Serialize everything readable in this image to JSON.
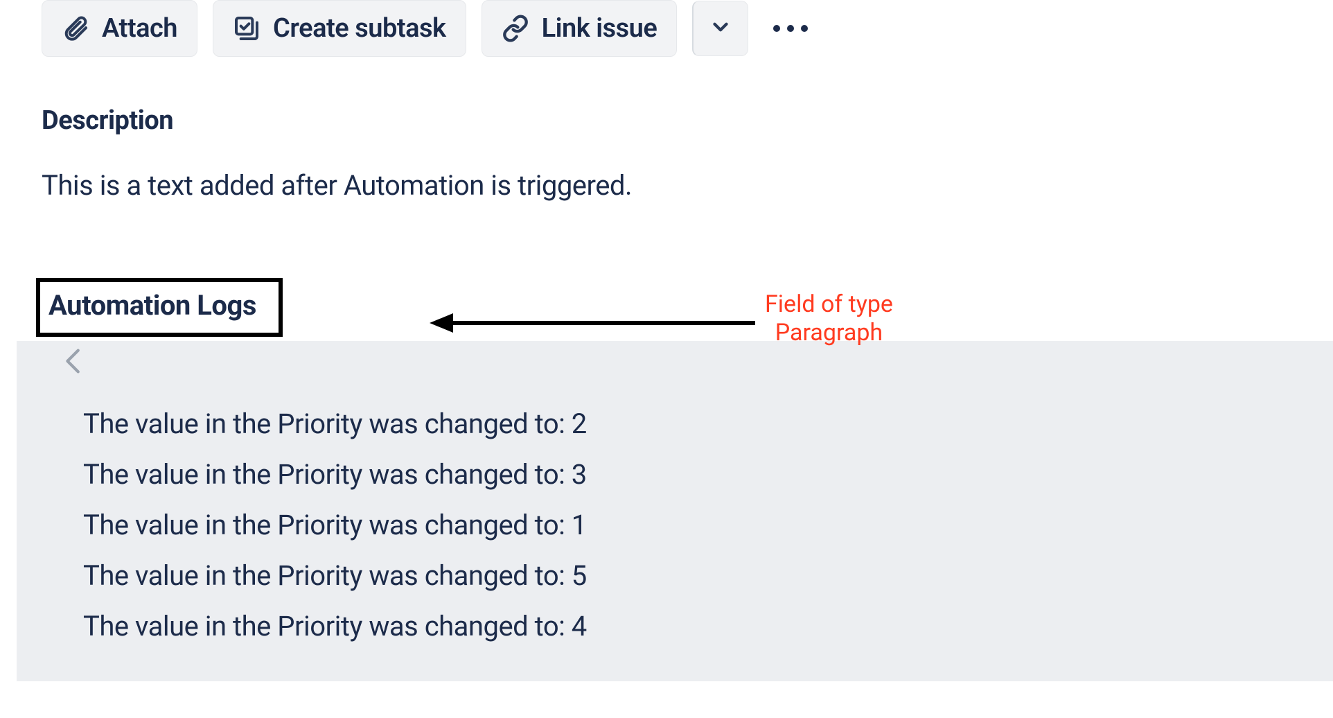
{
  "toolbar": {
    "attach_label": "Attach",
    "create_subtask_label": "Create subtask",
    "link_issue_label": "Link issue"
  },
  "description": {
    "heading": "Description",
    "text": "This is a text added after Automation is triggered."
  },
  "automation_logs": {
    "heading": "Automation Logs",
    "lines": [
      "The value in the Priority was changed to: 2",
      "The value in the Priority was changed to: 3",
      "The value in the Priority was changed to: 1",
      "The value in the Priority was changed to: 5",
      "The value in the Priority was changed to: 4"
    ]
  },
  "annotation": {
    "line1": "Field of type",
    "line2": "Paragraph"
  }
}
